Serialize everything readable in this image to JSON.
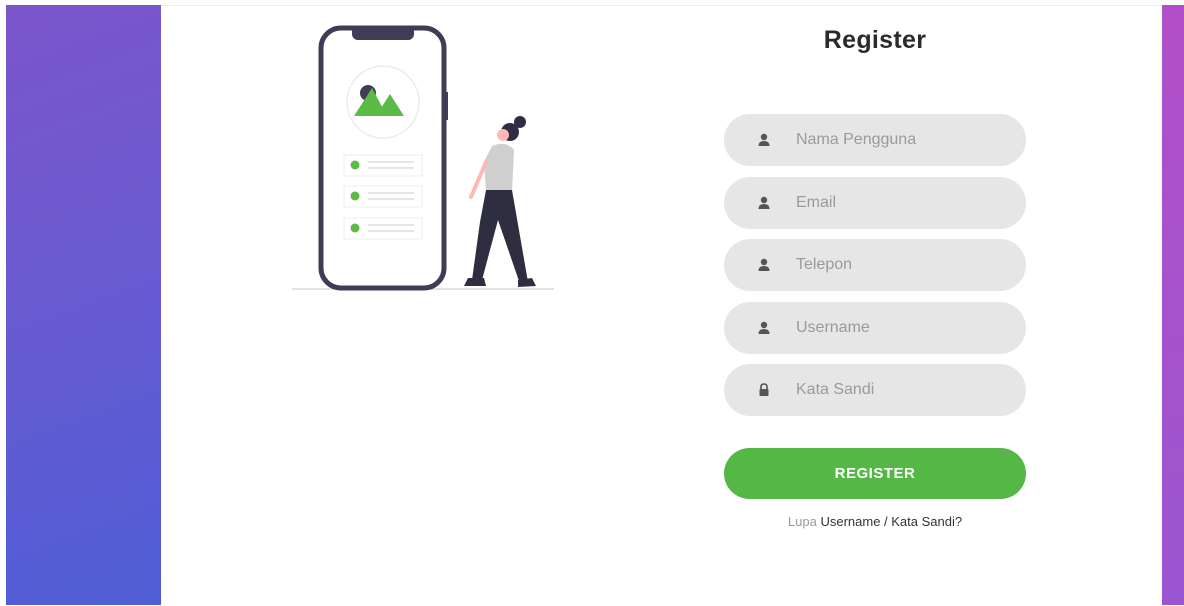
{
  "form": {
    "title": "Register",
    "fields": [
      {
        "placeholder": "Nama Pengguna",
        "icon": "user-icon"
      },
      {
        "placeholder": "Email",
        "icon": "user-icon"
      },
      {
        "placeholder": "Telepon",
        "icon": "user-icon"
      },
      {
        "placeholder": "Username",
        "icon": "user-icon"
      },
      {
        "placeholder": "Kata Sandi",
        "icon": "lock-icon"
      }
    ],
    "submit_label": "REGISTER",
    "forgot_prefix": "Lupa",
    "forgot_link": "Username / Kata Sandi?"
  },
  "colors": {
    "accent": "#55b746",
    "field_bg": "#e6e6e6",
    "bg_left_start": "#7b55cc",
    "bg_left_end": "#4f5ed6",
    "bg_right": "#a955cd"
  }
}
